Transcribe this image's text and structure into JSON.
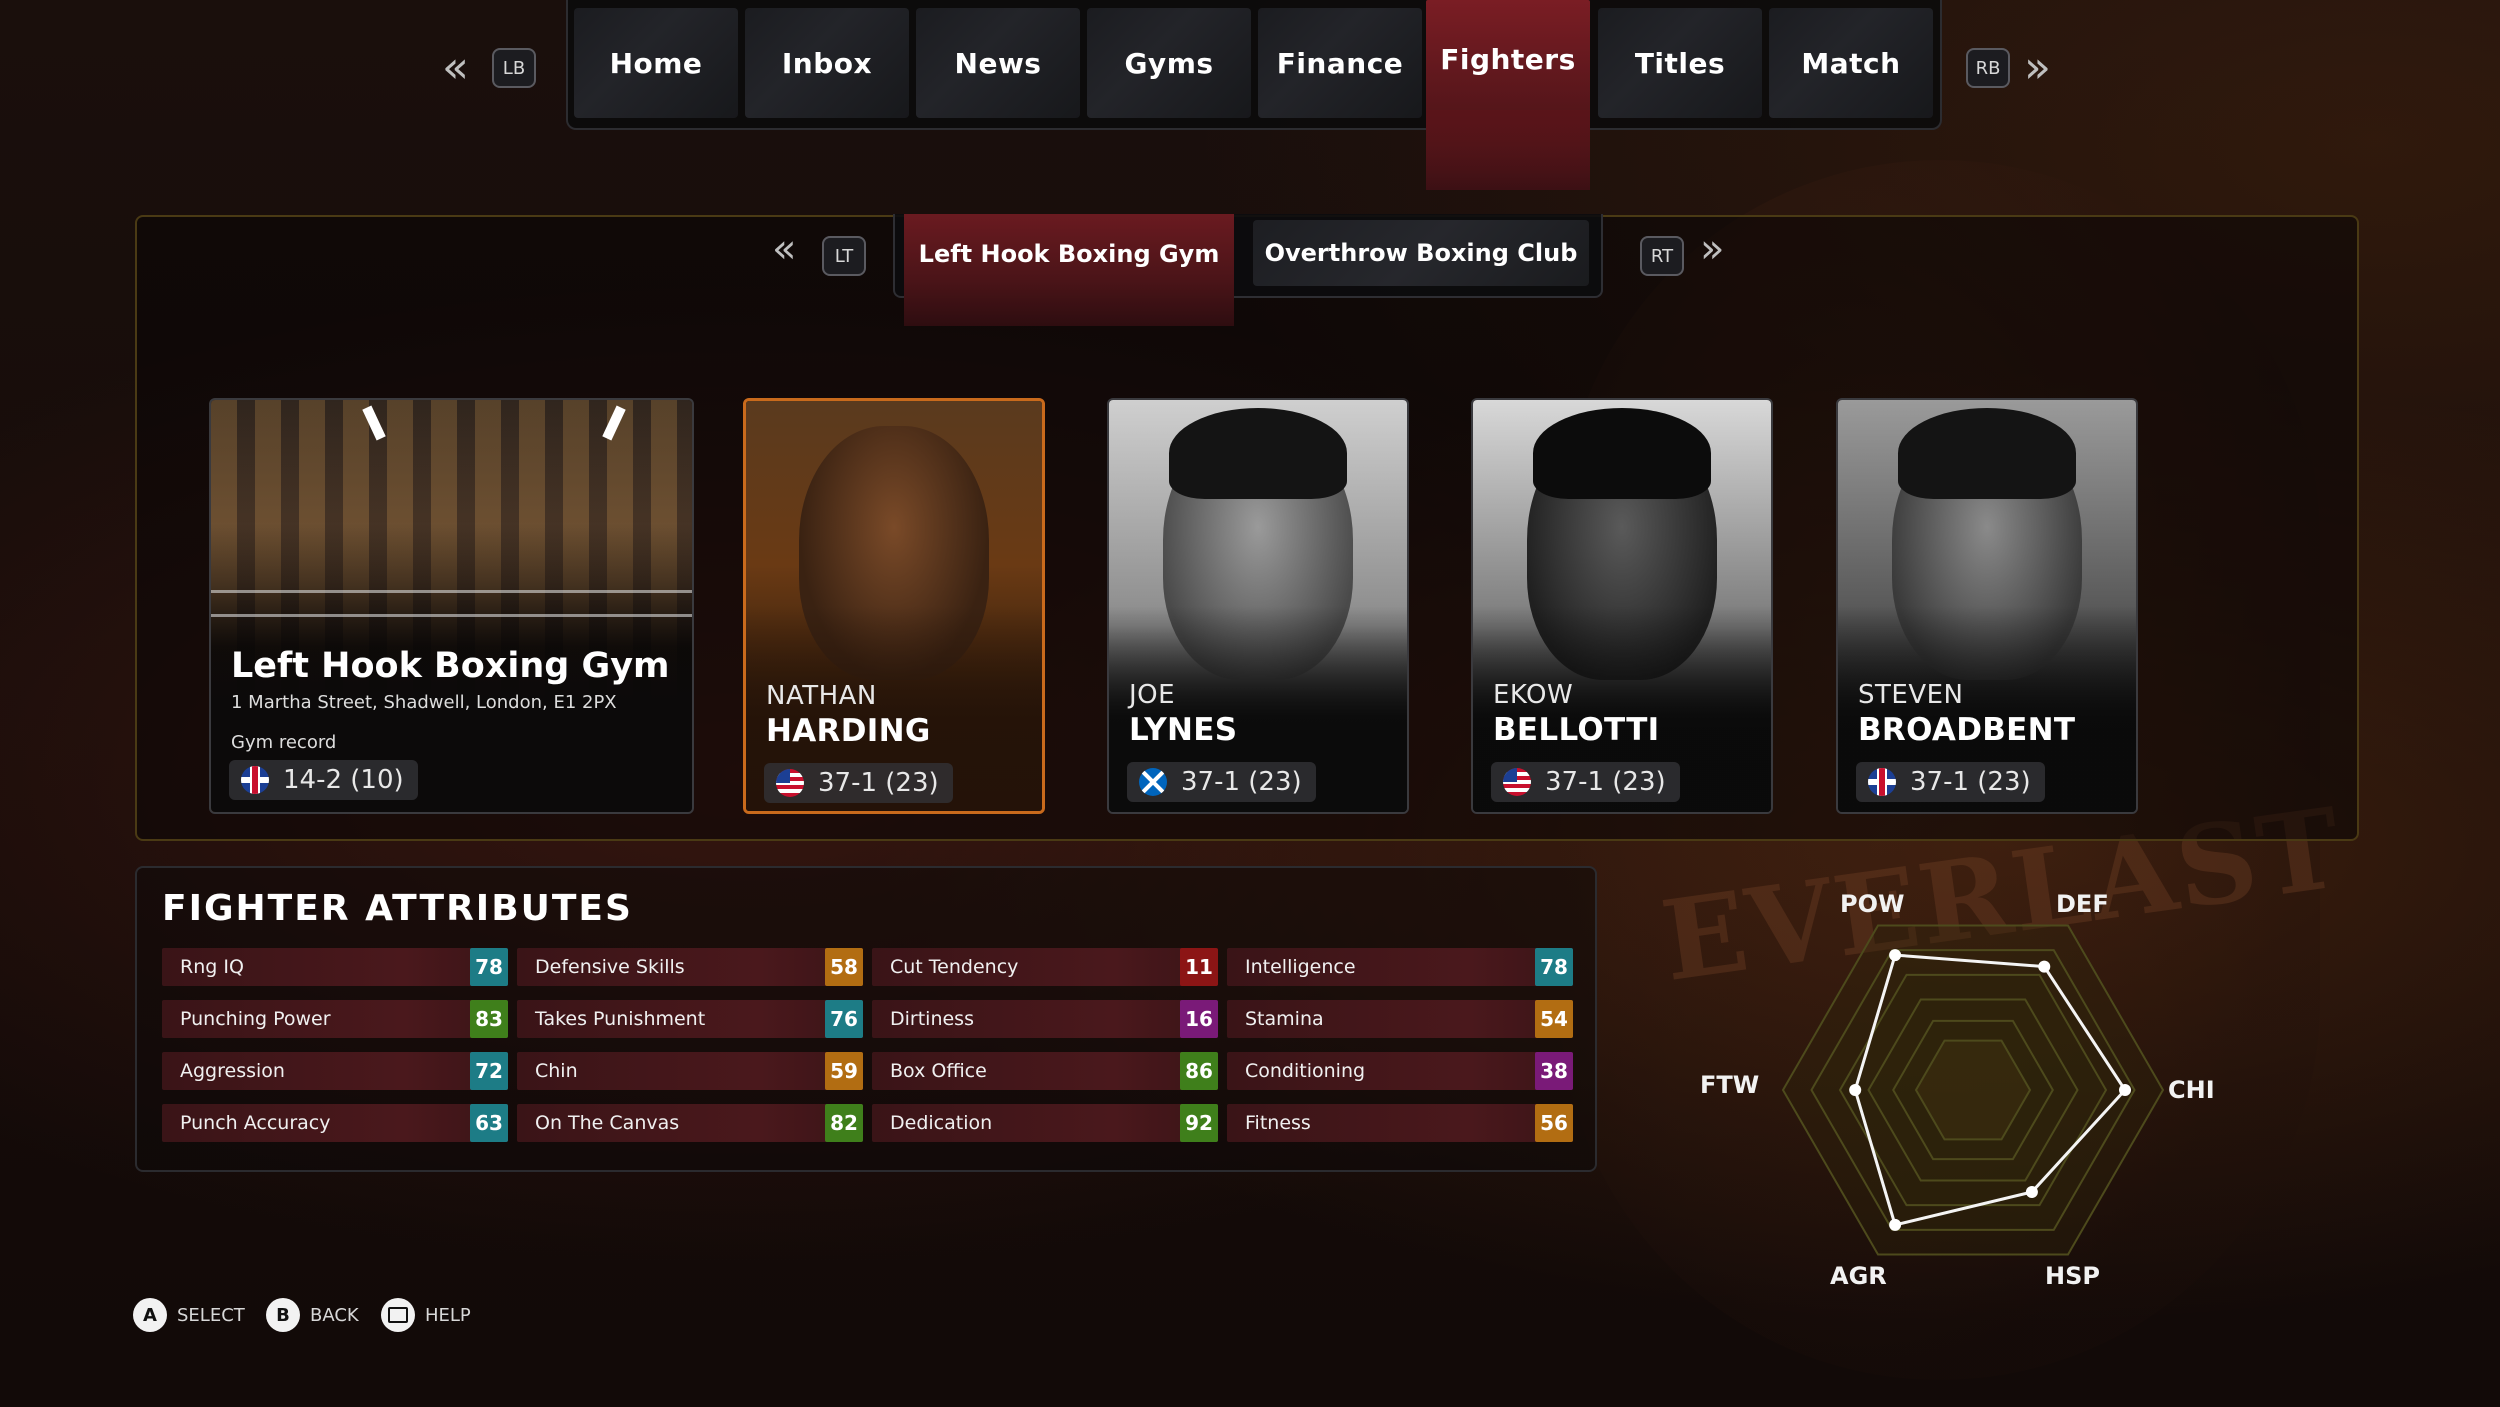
{
  "nav": {
    "prev_button": "LB",
    "next_button": "RB",
    "tabs": [
      "Home",
      "Inbox",
      "News",
      "Gyms",
      "Finance",
      "Fighters",
      "Titles",
      "Match"
    ],
    "active_tab": "Fighters"
  },
  "gym_tabs": {
    "prev_button": "LT",
    "next_button": "RT",
    "tabs": [
      "Left Hook Boxing Gym",
      "Overthrow Boxing Club"
    ],
    "active": "Left Hook Boxing Gym"
  },
  "gym_card": {
    "name": "Left Hook Boxing Gym",
    "address": "1 Martha Street, Shadwell, London, E1 2PX",
    "record_label": "Gym record",
    "record": "14-2 (10)",
    "flag": "uk"
  },
  "fighters": [
    {
      "first": "NATHAN",
      "last": "HARDING",
      "record": "37-1 (23)",
      "flag": "us",
      "selected": true
    },
    {
      "first": "JOE",
      "last": "LYNES",
      "record": "37-1 (23)",
      "flag": "sc",
      "selected": false
    },
    {
      "first": "EKOW",
      "last": "BELLOTTI",
      "record": "37-1 (23)",
      "flag": "us",
      "selected": false
    },
    {
      "first": "STEVEN",
      "last": "BROADBENT",
      "record": "37-1 (23)",
      "flag": "uk",
      "selected": false
    }
  ],
  "attributes": {
    "title": "FIGHTER ATTRIBUTES",
    "columns": [
      [
        {
          "label": "Rng IQ",
          "value": "78",
          "color": "#1d7c86"
        },
        {
          "label": "Punching Power",
          "value": "83",
          "color": "#3f7f1b"
        },
        {
          "label": "Aggression",
          "value": "72",
          "color": "#1d7c86"
        },
        {
          "label": "Punch Accuracy",
          "value": "63",
          "color": "#1d7c86"
        }
      ],
      [
        {
          "label": "Defensive Skills",
          "value": "58",
          "color": "#b26d12"
        },
        {
          "label": "Takes Punishment",
          "value": "76",
          "color": "#1d7c86"
        },
        {
          "label": "Chin",
          "value": "59",
          "color": "#b26d12"
        },
        {
          "label": "On The Canvas",
          "value": "82",
          "color": "#3f7f1b"
        }
      ],
      [
        {
          "label": "Cut Tendency",
          "value": "11",
          "color": "#8c1515"
        },
        {
          "label": "Dirtiness",
          "value": "16",
          "color": "#7a1a78"
        },
        {
          "label": "Box Office",
          "value": "86",
          "color": "#3f7f1b"
        },
        {
          "label": "Dedication",
          "value": "92",
          "color": "#3f7f1b"
        }
      ],
      [
        {
          "label": "Intelligence",
          "value": "78",
          "color": "#1d7c86"
        },
        {
          "label": "Stamina",
          "value": "54",
          "color": "#b26d12"
        },
        {
          "label": "Conditioning",
          "value": "38",
          "color": "#7a1a78"
        },
        {
          "label": "Fitness",
          "value": "56",
          "color": "#b26d12"
        }
      ]
    ]
  },
  "radar": {
    "axes": [
      "POW",
      "DEF",
      "CHI",
      "HSP",
      "AGR",
      "FTW"
    ],
    "values": [
      0.82,
      0.75,
      0.8,
      0.62,
      0.82,
      0.62
    ]
  },
  "footer": [
    {
      "key": "A",
      "label": "SELECT"
    },
    {
      "key": "B",
      "label": "BACK"
    },
    {
      "key": "help-icon",
      "label": "HELP"
    }
  ]
}
